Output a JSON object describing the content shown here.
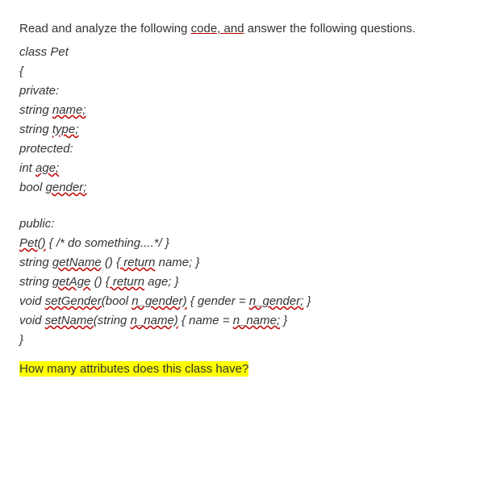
{
  "intro": {
    "prefix": "Read and analyze the following ",
    "code_and": "code, and",
    "suffix": " answer the following questions."
  },
  "code": {
    "l1": "class Pet",
    "l2": "{",
    "l3": "private:",
    "l4_pre": "string ",
    "l4_u": "name;",
    "l5_pre": "string ",
    "l5_u": "type;",
    "l6": "protected:",
    "l7_pre": "int ",
    "l7_u": "age;",
    "l8_pre": "bool ",
    "l8_u": "gender;",
    "l9": "public:",
    "l10_u": "Pet()",
    "l10_post": " { /* do something....*/ }",
    "l11_pre": "string ",
    "l11_u1": "getName",
    "l11_mid": " () ",
    "l11_u2": "{ return",
    "l11_post": " name; }",
    "l12_pre": "string ",
    "l12_u1": "getAge",
    "l12_mid": " () ",
    "l12_u2": "{ return",
    "l12_post": " age; }",
    "l13_pre": "void ",
    "l13_u1": "setGender(",
    "l13_mid1": "bool ",
    "l13_u2": "n_gender)",
    "l13_mid2": " { gender = ",
    "l13_u3": "n_gender;",
    "l13_post": " }",
    "l14_pre": "void ",
    "l14_u1": "setName(",
    "l14_mid1": "string ",
    "l14_u2": "n_name)",
    "l14_mid2": " { name = ",
    "l14_u3": "n_name;",
    "l14_post": " }",
    "l15": "}"
  },
  "question": "How many attributes does this class have?"
}
